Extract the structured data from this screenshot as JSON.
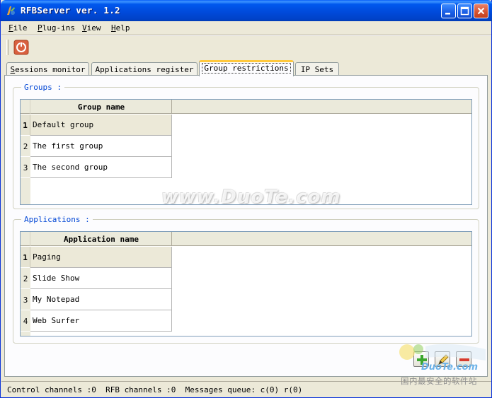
{
  "window": {
    "title": "RFBServer ver. 1.2"
  },
  "menu": {
    "file_key": "F",
    "file_rest": "ile",
    "plugins_key": "P",
    "plugins_rest": "lug-ins",
    "view_key": "V",
    "view_rest": "iew",
    "help_key": "H",
    "help_rest": "elp"
  },
  "toolbar": {
    "power_icon": "power-icon"
  },
  "tabs": [
    {
      "label_key": "S",
      "label_rest": "essions monitor",
      "active": false
    },
    {
      "label": "Applications register",
      "active": false
    },
    {
      "label": "Group restrictions",
      "active": true
    },
    {
      "label": "IP Sets",
      "active": false
    }
  ],
  "groups": {
    "title": "Groups :",
    "column_header": "Group name",
    "rows": [
      {
        "num": "1",
        "name": "Default group",
        "selected": true
      },
      {
        "num": "2",
        "name": "The first group",
        "selected": false
      },
      {
        "num": "3",
        "name": "The second group",
        "selected": false
      }
    ]
  },
  "applications": {
    "title": "Applications :",
    "column_header": "Application name",
    "rows": [
      {
        "num": "1",
        "name": "Paging",
        "selected": true
      },
      {
        "num": "2",
        "name": "Slide Show",
        "selected": false
      },
      {
        "num": "3",
        "name": "My Notepad",
        "selected": false
      },
      {
        "num": "4",
        "name": "Web Surfer",
        "selected": false
      }
    ]
  },
  "actions": {
    "add_icon": "plus-icon",
    "edit_icon": "edit-icon",
    "remove_icon": "minus-icon"
  },
  "status": {
    "text": "Control channels :0  RFB channels :0  Messages queue: c(0) r(0)"
  },
  "watermark": {
    "text": "www.DuoTe.com",
    "logo_url": "DuoTe.com",
    "logo_cn": "国内最安全的软件站"
  },
  "colors": {
    "title_bar": "#0054E3",
    "group_title": "#0046D5",
    "active_tab_highlight": "#FFC83C"
  }
}
